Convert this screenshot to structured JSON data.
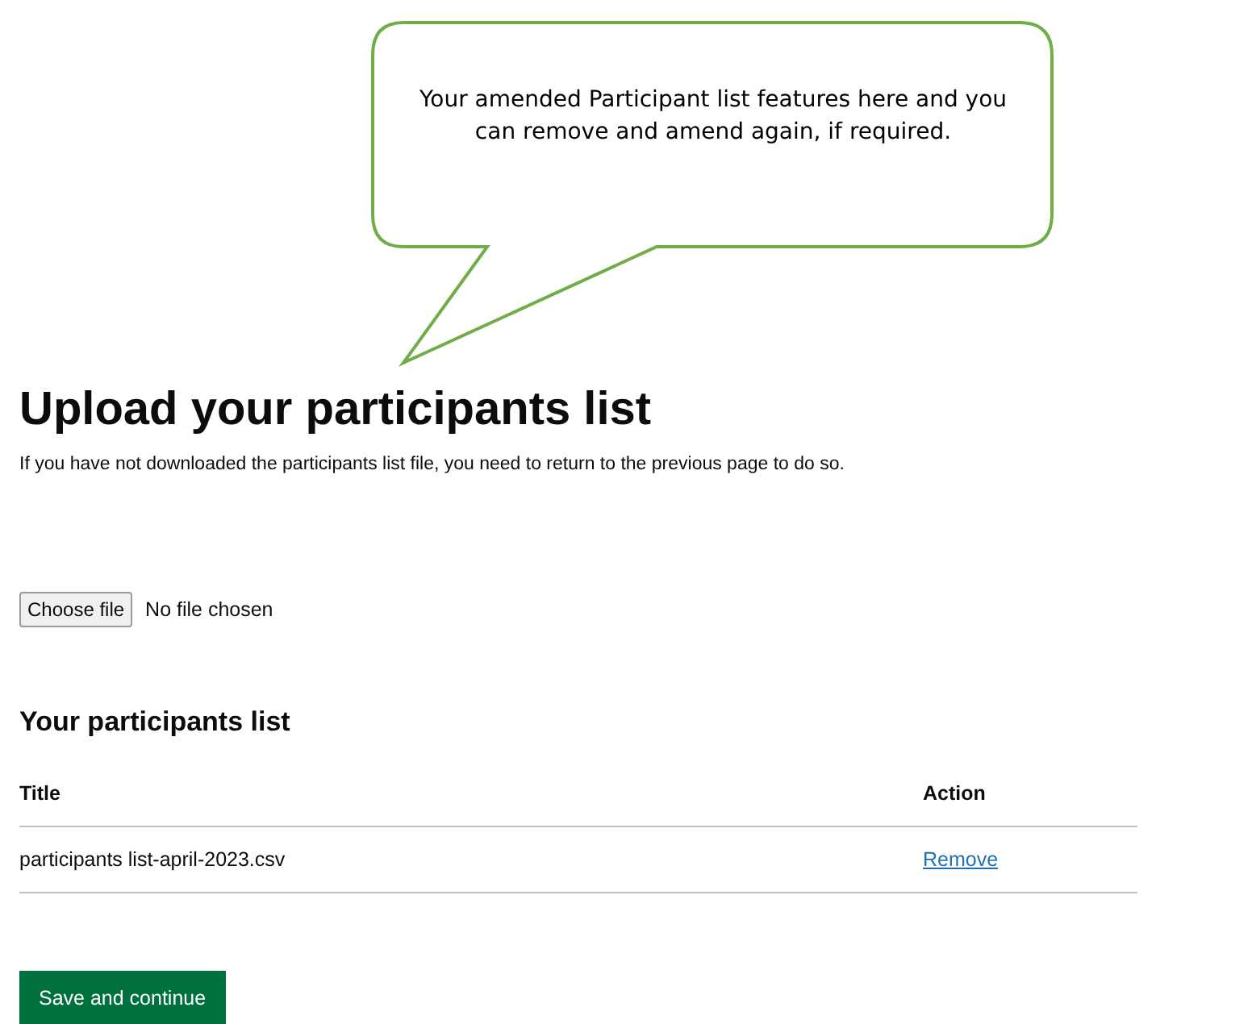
{
  "callout": {
    "text": "Your amended Participant list features here and you can remove and amend again, if required."
  },
  "heading": "Upload your participants list",
  "intro": "If you have not downloaded the participants list file, you need to return to the previous page to do so.",
  "file_input": {
    "button": "Choose file",
    "status": "No file chosen"
  },
  "list_heading": "Your participants list",
  "table": {
    "columns": [
      "Title",
      "Action"
    ],
    "rows": [
      {
        "title": "participants list-april-2023.csv",
        "action": "Remove"
      }
    ]
  },
  "primary_button": "Save and continue"
}
